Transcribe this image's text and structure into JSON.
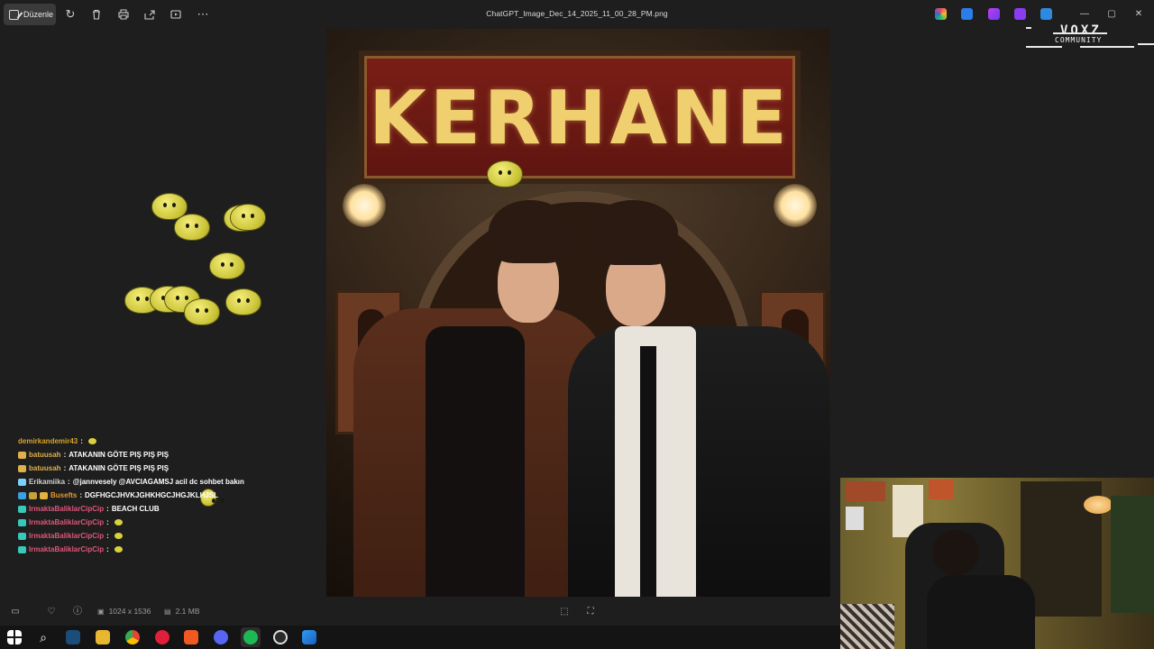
{
  "toolbar": {
    "edit_label": "Düzenle",
    "filename": "ChatGPT_Image_Dec_14_2025_11_00_28_PM.png",
    "tools": [
      "rotate-icon",
      "delete-icon",
      "print-icon",
      "share-icon",
      "slideshow-icon",
      "more-icon"
    ]
  },
  "watermark": {
    "line1": "VOXZ",
    "line2": "COMMUNITY"
  },
  "image": {
    "sign_text": "KERHANE"
  },
  "chat": {
    "messages": [
      {
        "user": "demirkandemir43",
        "sep": " :",
        "text": "",
        "color": "#d6a32a",
        "badges": []
      },
      {
        "user": "batuusah",
        "sep": " :",
        "text": "ATAKANIN GÖTE PIŞ PIŞ PIŞ",
        "color": "#e0b04a",
        "badges": [
          "#e0b04a"
        ]
      },
      {
        "user": "batuusah",
        "sep": " :",
        "text": "ATAKANIN GÖTE PIŞ PIŞ PIŞ",
        "color": "#e0b04a",
        "badges": [
          "#e0b04a"
        ]
      },
      {
        "user": "Erikamiika",
        "sep": " :",
        "text": "@jannvesely @AVCIAGAMSJ acil dc sohbet bakın",
        "color": "#d0d0d0",
        "badges": [
          "#7ad0ff"
        ]
      },
      {
        "user": "Busefts",
        "sep": " :",
        "text": "DGFHGCJHVKJGHKHGCJHGJKLHJSL",
        "color": "#e79a2a",
        "badges": [
          "#3aa0e0",
          "#c7a23a",
          "#e3b23a"
        ]
      },
      {
        "user": "IrmaktaBaliklarCipCip",
        "sep": " :",
        "text": "BEACH CLUB",
        "color": "#e0557a",
        "badges": [
          "#38c8b8"
        ]
      },
      {
        "user": "IrmaktaBaliklarCipCip",
        "sep": " :",
        "text": "",
        "color": "#e0557a",
        "badges": [
          "#38c8b8"
        ]
      },
      {
        "user": "IrmaktaBaliklarCipCip",
        "sep": " :",
        "text": "",
        "color": "#e0557a",
        "badges": [
          "#38c8b8"
        ]
      },
      {
        "user": "IrmaktaBaliklarCipCip",
        "sep": " :",
        "text": "",
        "color": "#e0557a",
        "badges": [
          "#38c8b8"
        ]
      }
    ]
  },
  "statusbar": {
    "dimensions": "1024 x 1536",
    "filesize": "2.1 MB"
  },
  "taskbar": {
    "apps": [
      "windows-start-icon",
      "search-icon",
      "steam-icon",
      "file-explorer-icon",
      "chrome-icon",
      "youtube-music-icon",
      "brave-icon",
      "discord-icon",
      "spotify-icon",
      "obs-icon",
      "photos-icon"
    ]
  },
  "colors": {
    "bg": "#1e1e1e",
    "sign_red": "#7a1e16",
    "sign_gold": "#f0cf6e"
  }
}
